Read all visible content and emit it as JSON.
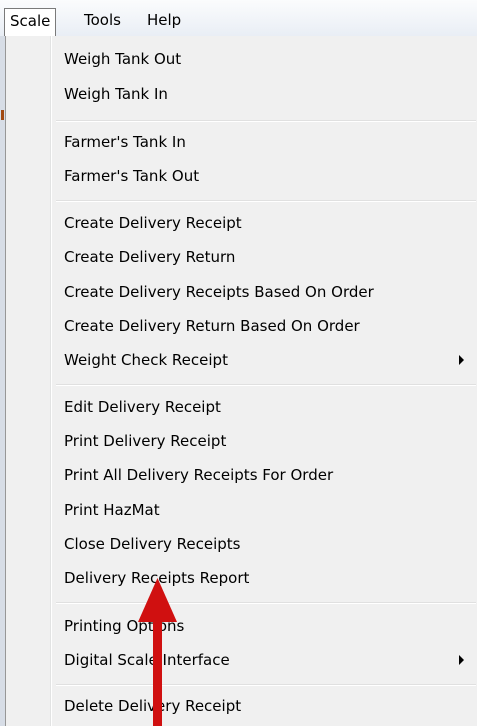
{
  "menubar": {
    "items": [
      {
        "label": "Scale"
      },
      {
        "label": "Tools"
      },
      {
        "label": "Help"
      }
    ]
  },
  "menu": {
    "groups": [
      {
        "items": [
          {
            "label": "Weigh Tank Out"
          },
          {
            "label": "Weigh Tank In"
          }
        ]
      },
      {
        "items": [
          {
            "label": "Farmer's Tank In"
          },
          {
            "label": "Farmer's Tank Out"
          }
        ]
      },
      {
        "items": [
          {
            "label": "Create Delivery Receipt"
          },
          {
            "label": "Create Delivery Return"
          },
          {
            "label": "Create Delivery Receipts Based On Order"
          },
          {
            "label": "Create Delivery Return Based On Order"
          },
          {
            "label": "Weight Check Receipt",
            "submenu": true
          }
        ]
      },
      {
        "items": [
          {
            "label": "Edit Delivery Receipt"
          },
          {
            "label": "Print Delivery Receipt"
          },
          {
            "label": "Print All Delivery Receipts For Order"
          },
          {
            "label": "Print HazMat"
          },
          {
            "label": "Close Delivery Receipts"
          },
          {
            "label": "Delivery Receipts Report"
          }
        ]
      },
      {
        "items": [
          {
            "label": "Printing Options"
          },
          {
            "label": "Digital Scale Interface",
            "submenu": true
          }
        ]
      },
      {
        "items": [
          {
            "label": "Delete Delivery Receipt"
          }
        ]
      }
    ]
  },
  "colors": {
    "menu_bg": "#f0f0f0",
    "annotation_arrow": "#d01010"
  }
}
